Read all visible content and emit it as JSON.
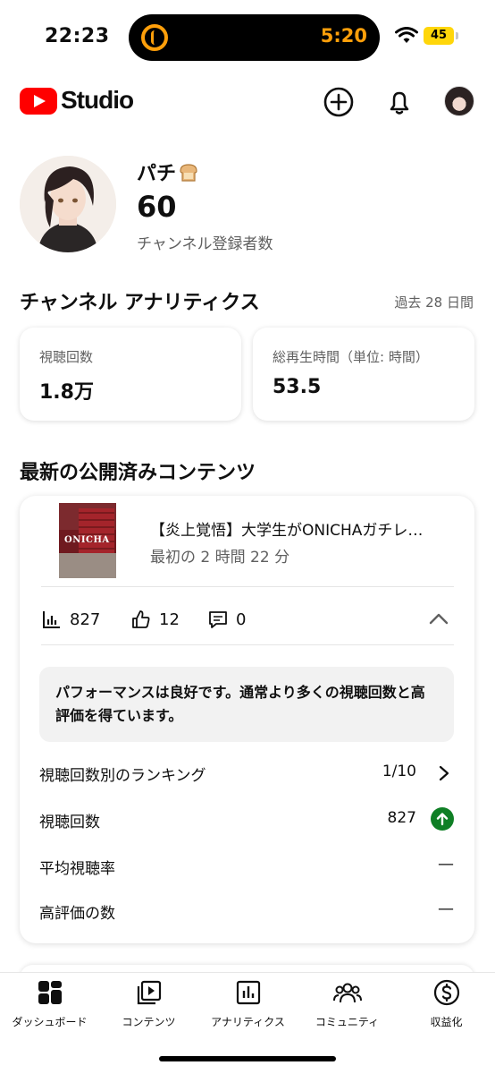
{
  "status_bar": {
    "time": "22:23",
    "island_timer": "5:20",
    "battery": "45",
    "icons": [
      "timer-icon",
      "wifi-icon",
      "battery-icon"
    ]
  },
  "header": {
    "logo_text": "Studio",
    "icons": [
      "youtube-logo-icon",
      "create-plus-icon",
      "notifications-bell-icon",
      "account-avatar"
    ]
  },
  "profile": {
    "channel_name": "パチ",
    "subscriber_count": "60",
    "subscriber_label": "チャンネル登録者数"
  },
  "analytics": {
    "title": "チャンネル アナリティクス",
    "period": "過去 28 日間",
    "cards": [
      {
        "label": "視聴回数",
        "value": "1.8万"
      },
      {
        "label": "総再生時間（単位: 時間）",
        "value": "53.5"
      }
    ]
  },
  "latest_content": {
    "title": "最新の公開済みコンテンツ",
    "thumbnail_text": "ONICHA",
    "video_title": "【炎上覚悟】大学生がONICHAガチレ…",
    "video_subtitle": "最初の 2 時間 22 分",
    "views": "827",
    "likes": "12",
    "comments": "0",
    "performance_message": "パフォーマンスは良好です。通常より多くの視聴回数と高評価を得ています。",
    "rows": [
      {
        "label": "視聴回数別のランキング",
        "value": "1/10"
      },
      {
        "label": "視聴回数",
        "value": "827"
      },
      {
        "label": "平均視聴率",
        "value": "—"
      },
      {
        "label": "高評価の数",
        "value": "—"
      }
    ]
  },
  "bottom_nav": {
    "items": [
      {
        "label": "ダッシュボード",
        "icon": "dashboard-icon"
      },
      {
        "label": "コンテンツ",
        "icon": "content-icon"
      },
      {
        "label": "アナリティクス",
        "icon": "analytics-icon"
      },
      {
        "label": "コミュニティ",
        "icon": "community-icon"
      },
      {
        "label": "収益化",
        "icon": "monetization-icon"
      }
    ]
  },
  "colors": {
    "brand_red": "#ff0000",
    "accent_orange": "#ff9f0a",
    "positive_green": "#0f7f25",
    "secondary_text": "#606060"
  }
}
